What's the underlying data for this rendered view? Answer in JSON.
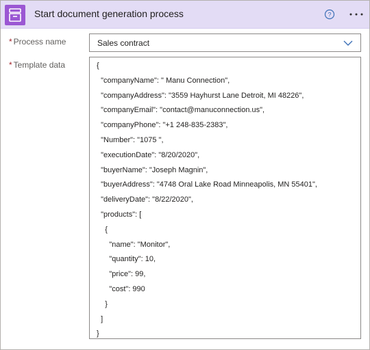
{
  "header": {
    "title": "Start document generation process",
    "app_icon": "file-cabinet-icon",
    "help_icon": "help-circle-icon",
    "more_icon": "more-ellipsis-icon",
    "accent_color": "#e3dcf5",
    "icon_color": "#9b57d3"
  },
  "form": {
    "required_mark": "*",
    "process_name": {
      "label": "Process name",
      "value": "Sales contract",
      "icon": "chevron-down-icon"
    },
    "template_data": {
      "label": "Template data",
      "lines": [
        "{",
        "  \"companyName\": \" Manu Connection\",",
        "  \"companyAddress\": \"3559 Hayhurst Lane Detroit, MI 48226\",",
        "  \"companyEmail\": \"contact@manuconnection.us\",",
        "  \"companyPhone\": \"+1 248-835-2383\",",
        "  \"Number\": \"1075 \",",
        "  \"executionDate\": \"8/20/2020\",",
        "  \"buyerName\": \"Joseph Magnin\",",
        "  \"buyerAddress\": \"4748 Oral Lake Road Minneapolis, MN 55401\",",
        "  \"deliveryDate\": \"8/22/2020\",",
        "  \"products\": [",
        "    {",
        "      \"name\": \"Monitor\",",
        "      \"quantity\": 10,",
        "      \"price\": 99,",
        "      \"cost\": 990",
        "    }",
        "  ]",
        "}"
      ]
    }
  }
}
